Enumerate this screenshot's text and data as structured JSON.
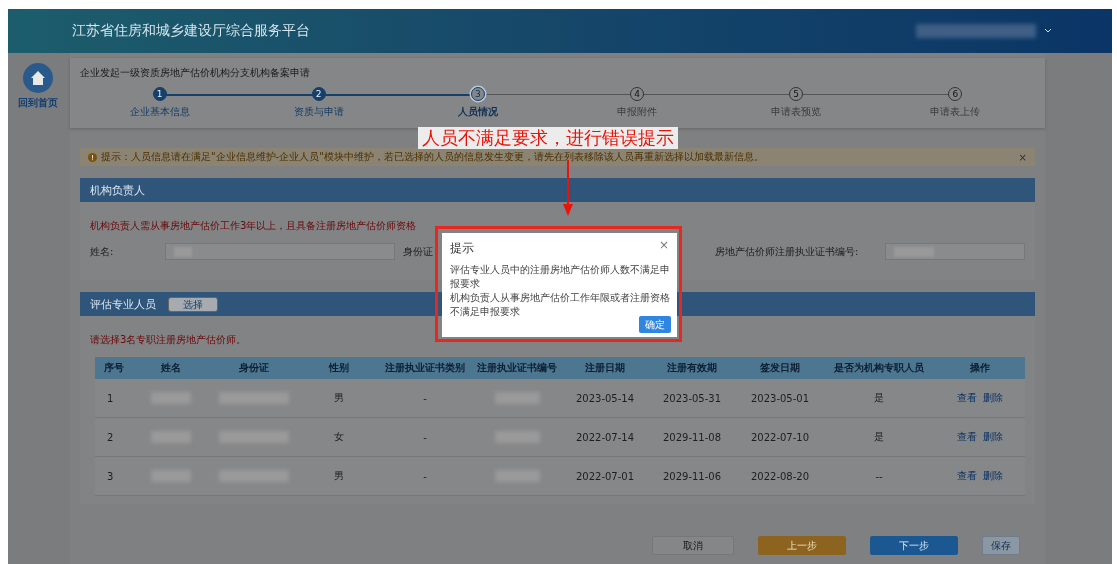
{
  "header": {
    "title": "江苏省住房和城乡建设厅综合服务平台"
  },
  "sidebar": {
    "home_label": "回到首页"
  },
  "page_title": "企业发起一级资质房地产估价机构分支机构备案申请",
  "steps": [
    {
      "number": "1",
      "label": "企业基本信息",
      "completed": true,
      "selected": false
    },
    {
      "number": "2",
      "label": "资质与申请",
      "completed": true,
      "selected": false
    },
    {
      "number": "3",
      "label": "人员情况",
      "completed": false,
      "selected": true
    },
    {
      "number": "4",
      "label": "申报附件",
      "completed": false,
      "selected": false
    },
    {
      "number": "5",
      "label": "申请表预览",
      "completed": false,
      "selected": false
    },
    {
      "number": "6",
      "label": "申请表上传",
      "completed": false,
      "selected": false
    }
  ],
  "notice": {
    "text": "提示：人员信息请在满足\"企业信息维护-企业人员\"模块中维护，若已选择的人员的信息发生变更，请先在列表移除该人员再重新选择以加载最新信息。",
    "close": "×"
  },
  "manager_section": {
    "title": "机构负责人",
    "requirement": "机构负责人需从事房地产估价工作3年以上，且具备注册房地产估价师资格",
    "fields": [
      {
        "label": "姓名:"
      },
      {
        "label": "身份证"
      },
      {
        "label": "房地产估价师注册执业证书编号:"
      }
    ]
  },
  "staff_section": {
    "title": "评估专业人员",
    "select_button": "选择",
    "requirement": "请选择3名专职注册房地产估价师。",
    "columns": [
      "序号",
      "姓名",
      "身份证",
      "性别",
      "注册执业证书类别",
      "注册执业证书编号",
      "注册日期",
      "注册有效期",
      "签发日期",
      "是否为机构专职人员",
      "操作"
    ],
    "rows": [
      {
        "index": "1",
        "gender": "男",
        "cert_type": "-",
        "reg_date": "2023-05-14",
        "valid_until": "2023-05-31",
        "issue_date": "2023-05-01",
        "full_time": "是",
        "actions": [
          "查看",
          "删除"
        ]
      },
      {
        "index": "2",
        "gender": "女",
        "cert_type": "-",
        "reg_date": "2022-07-14",
        "valid_until": "2029-11-08",
        "issue_date": "2022-07-10",
        "full_time": "是",
        "actions": [
          "查看",
          "删除"
        ]
      },
      {
        "index": "3",
        "gender": "男",
        "cert_type": "-",
        "reg_date": "2022-07-01",
        "valid_until": "2029-11-06",
        "issue_date": "2022-08-20",
        "full_time": "--",
        "actions": [
          "查看",
          "删除"
        ]
      }
    ]
  },
  "footer_buttons": [
    {
      "label": "取消",
      "kind": "default"
    },
    {
      "label": "上一步",
      "kind": "warning"
    },
    {
      "label": "下一步",
      "kind": "primary"
    },
    {
      "label": "保存",
      "kind": "plain"
    }
  ],
  "annotation": {
    "text": "人员不满足要求，进行错误提示"
  },
  "dialog": {
    "title": "提示",
    "close": "×",
    "messages": [
      "评估专业人员中的注册房地产估价师人数不满足申报要求",
      "机构负责人从事房地产估价工作年限或者注册资格不满足申报要求"
    ],
    "confirm": "确定"
  }
}
